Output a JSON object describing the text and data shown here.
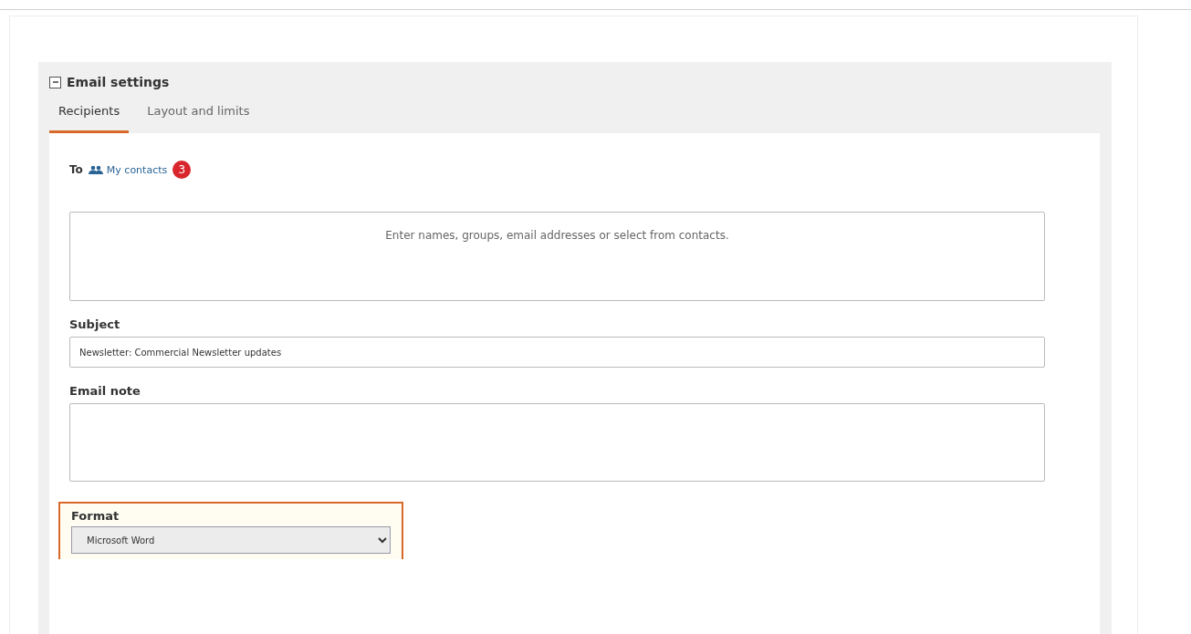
{
  "section": {
    "title": "Email settings",
    "expanded": true
  },
  "tabs": [
    {
      "label": "Recipients",
      "selected": true
    },
    {
      "label": "Layout and limits",
      "selected": false
    }
  ],
  "recipients": {
    "label": "To",
    "link": "My contacts",
    "count": "3",
    "placeholder": "Enter names, groups, email addresses or select from contacts."
  },
  "subject": {
    "label": "Subject",
    "value": "Newsletter: Commercial Newsletter updates"
  },
  "note": {
    "label": "Email note"
  },
  "format": {
    "label": "Format",
    "value": "Microsoft Word",
    "highlighted": true
  }
}
